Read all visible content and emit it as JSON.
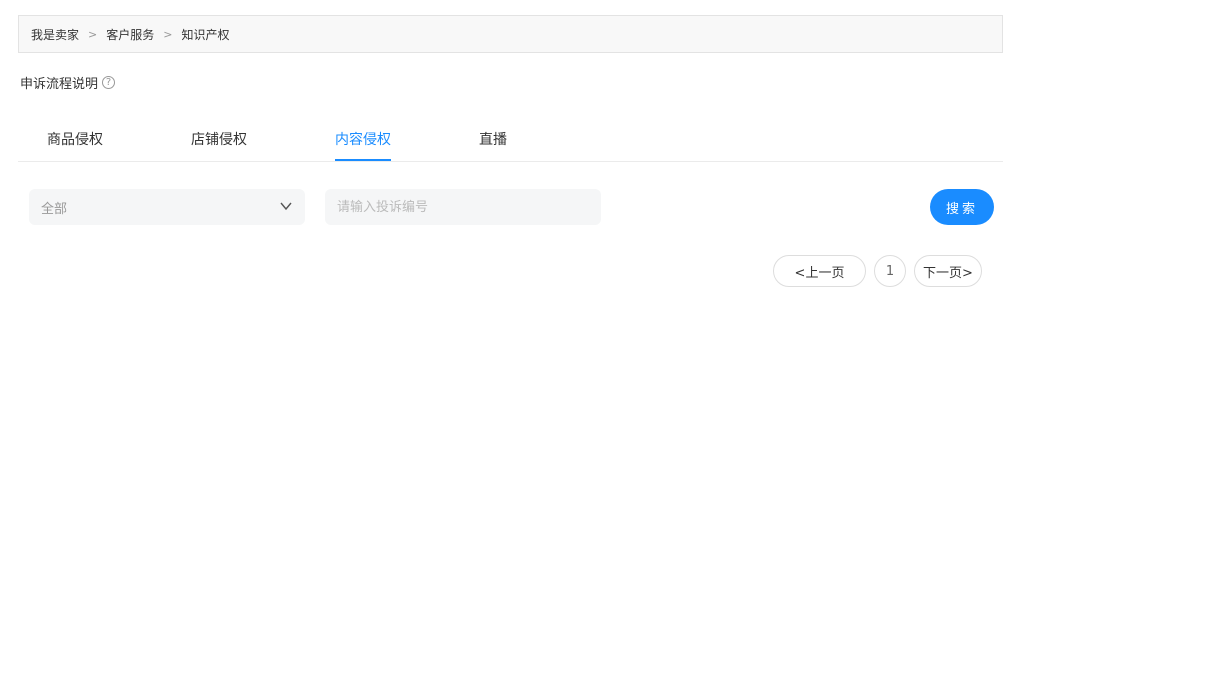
{
  "breadcrumb": {
    "items": [
      "我是卖家",
      "客户服务",
      "知识产权"
    ],
    "separator": ">"
  },
  "appeal": {
    "label": "申诉流程说明",
    "help_icon": "question-circle-icon",
    "help_glyph": "?"
  },
  "tabs": [
    {
      "label": "商品侵权",
      "active": false
    },
    {
      "label": "店铺侵权",
      "active": false
    },
    {
      "label": "内容侵权",
      "active": true
    },
    {
      "label": "直播",
      "active": false
    }
  ],
  "filter": {
    "select_value": "全部",
    "select_icon": "chevron-down-icon",
    "search_placeholder": "请输入投诉编号",
    "search_value": "",
    "search_button": "搜索"
  },
  "pagination": {
    "prev": "<上一页",
    "current_page": "1",
    "next": "下一页>"
  },
  "colors": {
    "accent": "#1a8cff",
    "input_bg": "#f5f6f7",
    "breadcrumb_bg": "#f8f8f8"
  }
}
